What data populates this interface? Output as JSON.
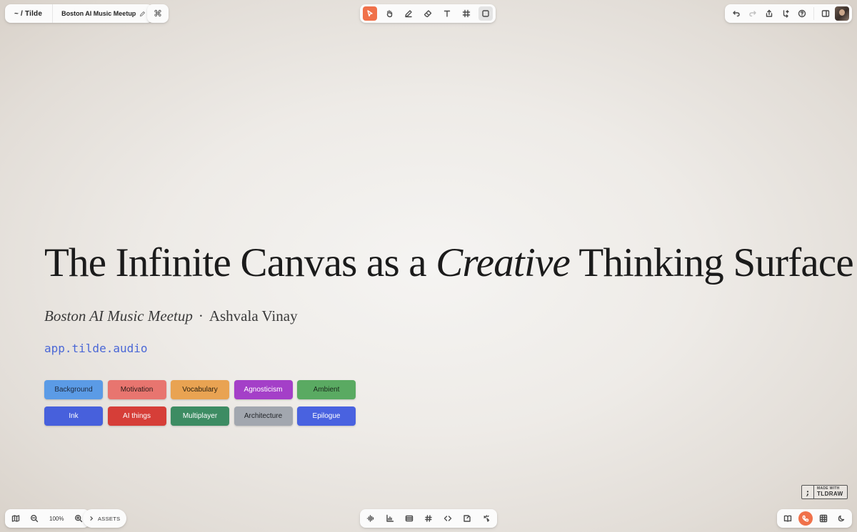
{
  "app": {
    "breadcrumb": "~ / Tilde",
    "document_title": "Boston AI Music Meetup",
    "command_symbol": "⌘"
  },
  "toolbar": {
    "tools": [
      {
        "name": "select",
        "icon": "cursor-icon",
        "active": true
      },
      {
        "name": "hand",
        "icon": "hand-icon"
      },
      {
        "name": "draw",
        "icon": "pencil-icon"
      },
      {
        "name": "eraser",
        "icon": "eraser-icon"
      },
      {
        "name": "text",
        "icon": "text-icon"
      },
      {
        "name": "frame",
        "icon": "frame-icon"
      },
      {
        "name": "rectangle",
        "icon": "rectangle-icon",
        "selected": true
      }
    ]
  },
  "top_right": {
    "actions": [
      "undo-icon",
      "redo-icon",
      "share-icon",
      "fork-icon",
      "help-icon",
      "sidebar-icon",
      "avatar"
    ]
  },
  "bottom_left": {
    "zoom": "100%",
    "assets_label": "ASSETS"
  },
  "bottom_tools": [
    "waveform-icon",
    "chart-icon",
    "list-icon",
    "hash-icon",
    "code-icon",
    "note-icon",
    "sparkle-icon"
  ],
  "bottom_right": [
    "book-icon",
    "phone-icon",
    "grid-icon",
    "moon-icon"
  ],
  "watermark": {
    "small": "MADE WITH",
    "big": "TLDRAW"
  },
  "slide": {
    "title_before": "The Infinite Canvas as a ",
    "title_emphasis": "Creative",
    "title_after": " Thinking Surface",
    "event": "Boston AI Music Meetup",
    "separator": "·",
    "author": "Ashvala Vinay",
    "url": "app.tilde.audio"
  },
  "chips": [
    {
      "label": "Background",
      "bg": "#5b9be6",
      "fg": "#1d2a40"
    },
    {
      "label": "Motivation",
      "bg": "#e8756f",
      "fg": "#2b1a18"
    },
    {
      "label": "Vocabulary",
      "bg": "#e9a352",
      "fg": "#2f2310"
    },
    {
      "label": "Agnosticism",
      "bg": "#a43fc8",
      "fg": "#ffffff"
    },
    {
      "label": "Ambient",
      "bg": "#5aaa62",
      "fg": "#1a2b1c"
    },
    {
      "label": "Ink",
      "bg": "#4760dc",
      "fg": "#ffffff"
    },
    {
      "label": "AI things",
      "bg": "#d63e38",
      "fg": "#ffffff"
    },
    {
      "label": "Multiplayer",
      "bg": "#3d8c63",
      "fg": "#ffffff"
    },
    {
      "label": "Architecture",
      "bg": "#a2a7af",
      "fg": "#1f2226"
    },
    {
      "label": "Epilogue",
      "bg": "#4962e0",
      "fg": "#ffffff"
    }
  ]
}
